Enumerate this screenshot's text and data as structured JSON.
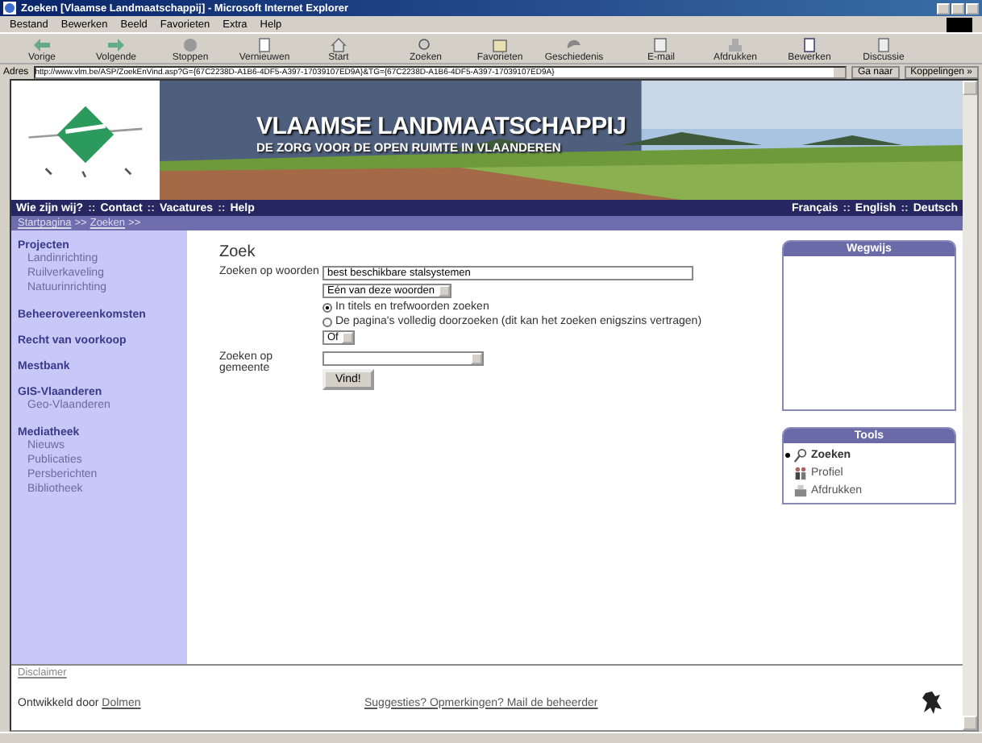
{
  "window": {
    "title": "Zoeken [Vlaamse Landmaatschappij] - Microsoft Internet Explorer"
  },
  "menu": [
    "Bestand",
    "Bewerken",
    "Beeld",
    "Favorieten",
    "Extra",
    "Help"
  ],
  "toolbar": [
    {
      "label": "Vorige",
      "kind": "back"
    },
    {
      "label": "Volgende",
      "kind": "forward"
    },
    {
      "label": "Stoppen",
      "kind": "stop"
    },
    {
      "label": "Vernieuwen",
      "kind": "refresh"
    },
    {
      "label": "Start",
      "kind": "home"
    },
    {
      "label": "Zoeken",
      "kind": "search"
    },
    {
      "label": "Favorieten",
      "kind": "favorites"
    },
    {
      "label": "Geschiedenis",
      "kind": "history"
    },
    {
      "label": "E-mail",
      "kind": "mail"
    },
    {
      "label": "Afdrukken",
      "kind": "print"
    },
    {
      "label": "Bewerken",
      "kind": "edit"
    },
    {
      "label": "Discussie",
      "kind": "discuss"
    }
  ],
  "address": {
    "label": "Adres",
    "value": "http://www.vlm.be/ASP/ZoekEnVind.asp?G={67C2238D-A1B6-4DF5-A397-17039107ED9A}&TG={67C2238D-A1B6-4DF5-A397-17039107ED9A}",
    "go": "Ga naar",
    "links": "Koppelingen »"
  },
  "banner": {
    "title": "VLAAMSE LANDMAATSCHAPPIJ",
    "subtitle": "DE ZORG VOOR DE OPEN RUIMTE IN VLAANDEREN"
  },
  "nav": {
    "links": [
      "Wie zijn wij?",
      "Contact",
      "Vacatures",
      "Help"
    ],
    "separator": "::",
    "languages": [
      "Français",
      "English",
      "Deutsch"
    ]
  },
  "breadcrumb": [
    {
      "label": "Startpagina"
    },
    {
      "label": "Zoeken"
    }
  ],
  "breadcrumb_separator": ">>",
  "sidebar": [
    {
      "label": "Projecten",
      "children": [
        {
          "label": "Landinrichting"
        },
        {
          "label": "Ruilverkaveling"
        },
        {
          "label": "Natuurinrichting"
        }
      ]
    },
    {
      "label": "Beheerovereenkomsten"
    },
    {
      "label": "Recht van voorkoop"
    },
    {
      "label": "Mestbank"
    },
    {
      "label": "GIS-Vlaanderen",
      "children": [
        {
          "label": "Geo-Vlaanderen"
        }
      ]
    },
    {
      "label": "Mediatheek",
      "children": [
        {
          "label": "Nieuws"
        },
        {
          "label": "Publicaties"
        },
        {
          "label": "Persberichten"
        },
        {
          "label": "Bibliotheek"
        }
      ]
    }
  ],
  "search": {
    "heading": "Zoek",
    "words_label": "Zoeken op woorden",
    "words_value": "best beschikbare stalsystemen",
    "mode": "Eén van deze woorden",
    "scopes": [
      {
        "label": "In titels en trefwoorden zoeken",
        "selected": true
      },
      {
        "label": "De pagina's volledig doorzoeken (dit kan het zoeken enigszins vertragen)",
        "selected": false
      }
    ],
    "operator": "Of",
    "municipality_label": "Zoeken op gemeente",
    "submit": "Vind!"
  },
  "wegwijs": {
    "title": "Wegwijs"
  },
  "tools": {
    "title": "Tools",
    "items": [
      {
        "label": "Zoeken",
        "kind": "search",
        "selected": true
      },
      {
        "label": "Profiel",
        "kind": "profile",
        "selected": false
      },
      {
        "label": "Afdrukken",
        "kind": "print",
        "selected": false
      }
    ]
  },
  "footer": {
    "disclaimer": "Disclaimer",
    "developed": "Ontwikkeld door",
    "developer": "Dolmen",
    "feedback": "Suggesties? Opmerkingen? Mail de beheerder"
  }
}
